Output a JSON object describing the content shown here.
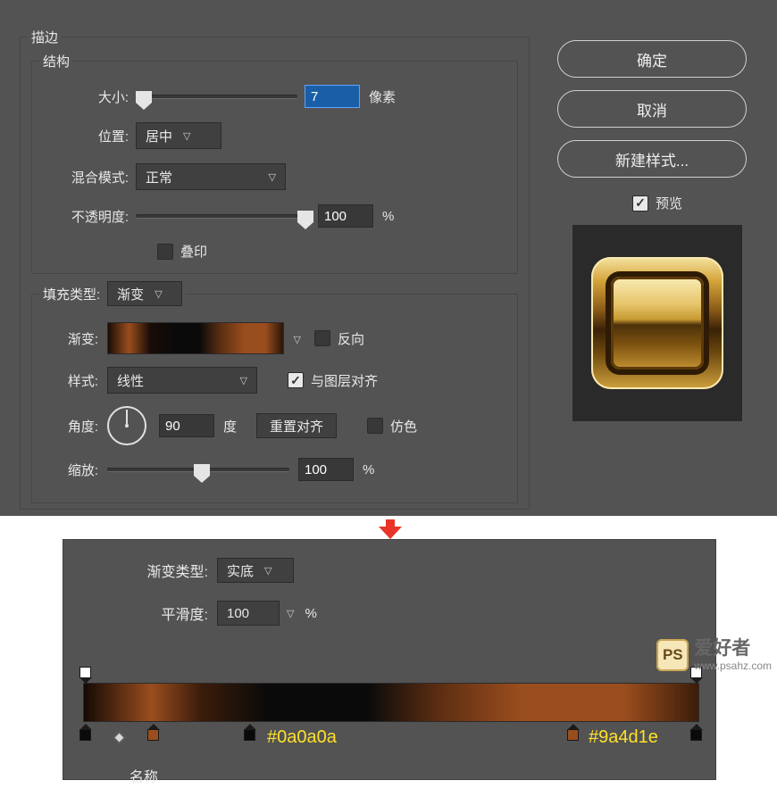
{
  "stroke": {
    "title": "描边",
    "structure": {
      "title": "结构",
      "size_label": "大小:",
      "size_value": "7",
      "size_unit": "像素",
      "position_label": "位置:",
      "position_value": "居中",
      "blend_label": "混合模式:",
      "blend_value": "正常",
      "opacity_label": "不透明度:",
      "opacity_value": "100",
      "opacity_unit": "%",
      "overprint_label": "叠印"
    },
    "fill": {
      "legend": "填充类型:",
      "type_value": "渐变",
      "gradient_label": "渐变:",
      "reverse_label": "反向",
      "style_label": "样式:",
      "style_value": "线性",
      "align_label": "与图层对齐",
      "angle_label": "角度:",
      "angle_value": "90",
      "angle_unit": "度",
      "reset_label": "重置对齐",
      "dither_label": "仿色",
      "scale_label": "缩放:",
      "scale_value": "100",
      "scale_unit": "%"
    }
  },
  "buttons": {
    "ok": "确定",
    "cancel": "取消",
    "new_style": "新建样式...",
    "preview": "预览"
  },
  "editor": {
    "type_label": "渐变类型:",
    "type_value": "实底",
    "smooth_label": "平滑度:",
    "smooth_value": "100",
    "smooth_unit": "%",
    "hex1": "#0a0a0a",
    "hex2": "#9a4d1e",
    "stub": "名称"
  },
  "watermark": {
    "ps": "PS",
    "cn": "爱好者",
    "url": "www.psahz.com"
  }
}
